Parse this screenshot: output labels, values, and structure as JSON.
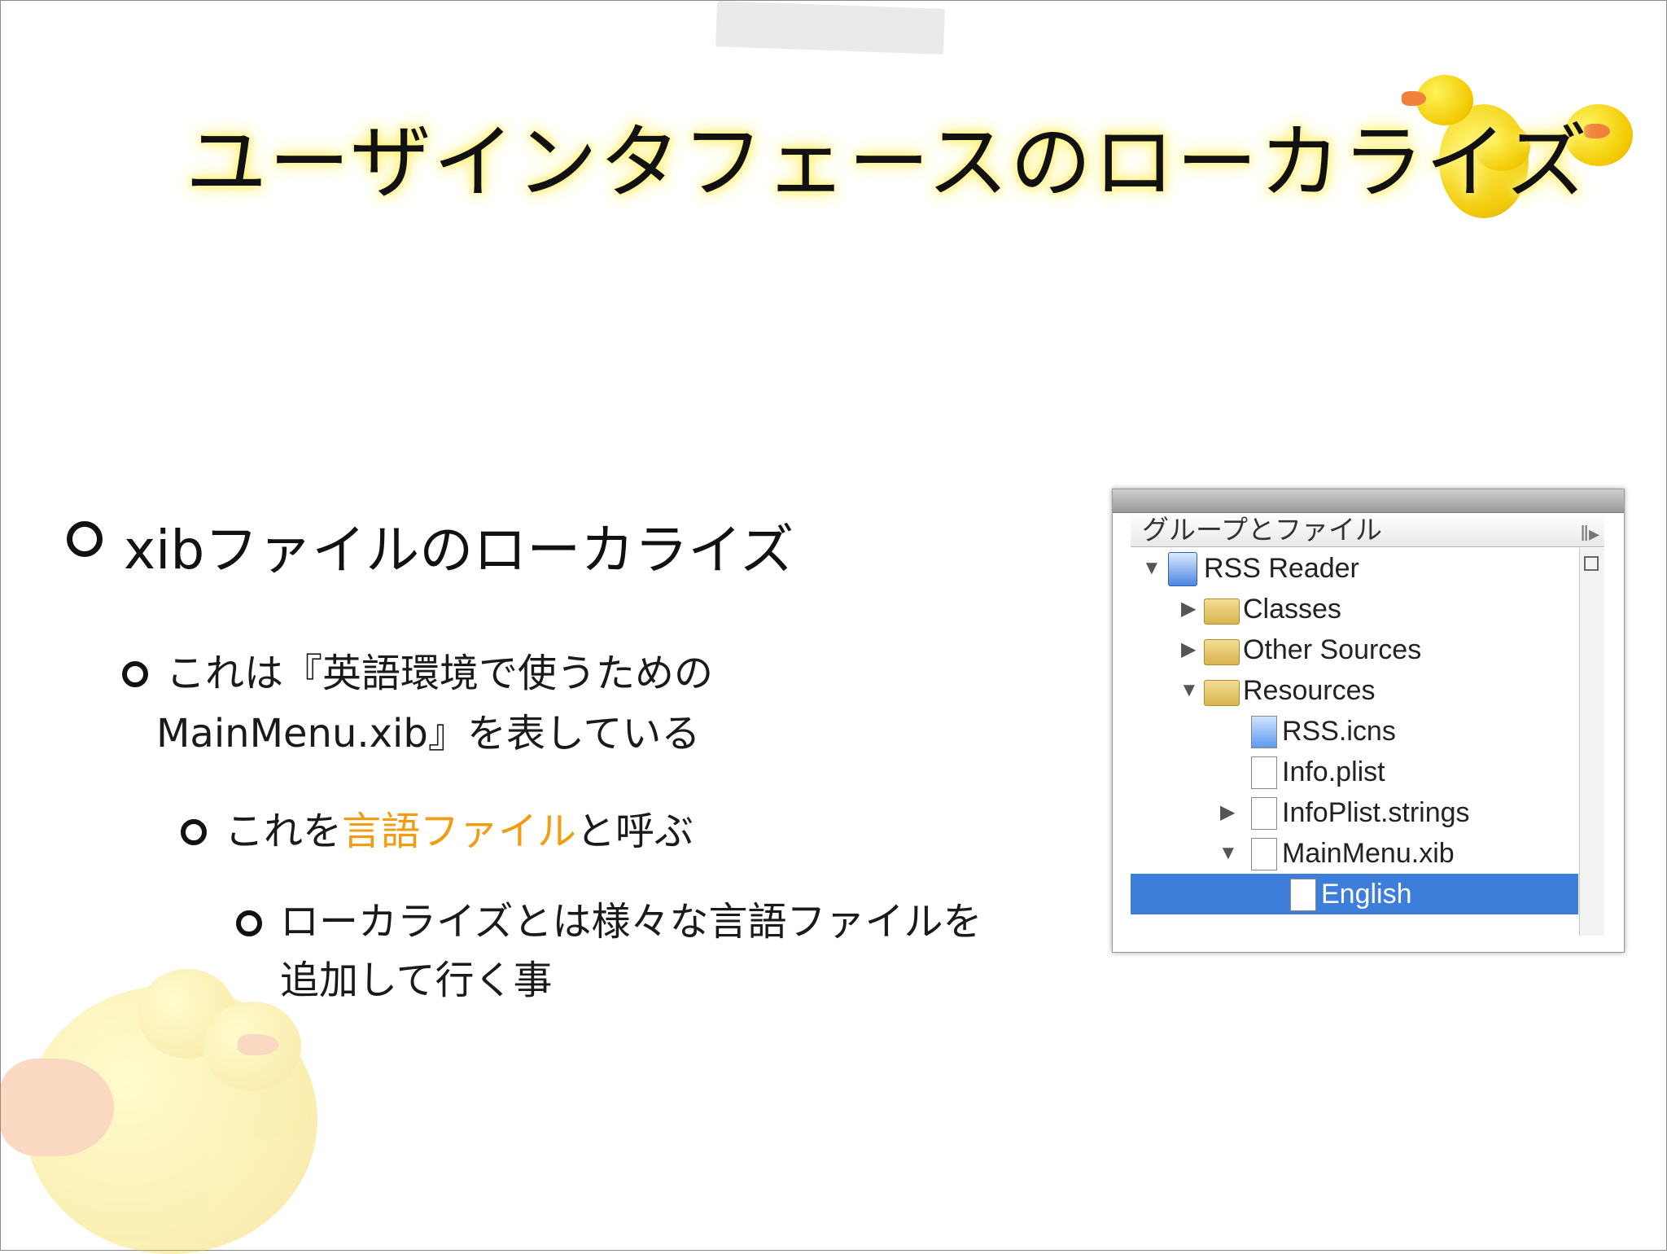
{
  "slide": {
    "title": "ユーザインタフェースのローカライズ",
    "bullets": {
      "level1": "xibファイルのローカライズ",
      "level2_line1": "これは『英語環境で使うための",
      "level2_line2": "MainMenu.xib』を表している",
      "level3_pre": "これを",
      "level3_highlight": "言語ファイル",
      "level3_post": "と呼ぶ",
      "level4_line1": "ローカライズとは様々な言語ファイルを",
      "level4_line2": "追加して行く事"
    },
    "highlight_color": "#f39c12"
  },
  "panel": {
    "header": "グループとファイル",
    "rows": [
      {
        "label": "RSS Reader",
        "expanded": true,
        "icon": "project-icon"
      },
      {
        "label": "Classes",
        "expanded": false,
        "icon": "folder-icon"
      },
      {
        "label": "Other Sources",
        "expanded": false,
        "icon": "folder-icon"
      },
      {
        "label": "Resources",
        "expanded": true,
        "icon": "folder-icon"
      },
      {
        "label": "RSS.icns",
        "icon": "icns-file-icon"
      },
      {
        "label": "Info.plist",
        "icon": "plist-file-icon"
      },
      {
        "label": "InfoPlist.strings",
        "expanded": false,
        "icon": "strings-file-icon"
      },
      {
        "label": "MainMenu.xib",
        "expanded": true,
        "icon": "xib-file-icon"
      },
      {
        "label": "English",
        "selected": true,
        "icon": "xib-file-icon"
      }
    ],
    "selection_color": "#3d7edb"
  }
}
